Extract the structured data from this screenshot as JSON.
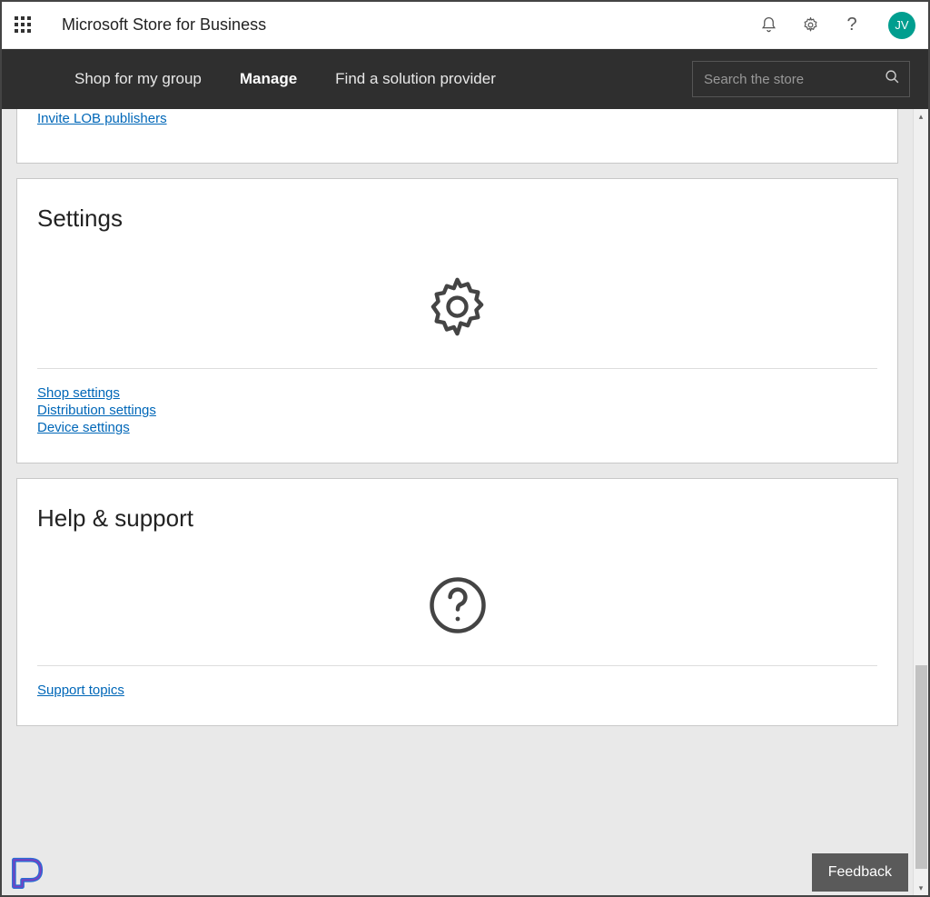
{
  "header": {
    "brand": "Microsoft Store for Business",
    "avatar_initials": "JV"
  },
  "nav": {
    "items": [
      {
        "label": "Shop for my group",
        "active": false
      },
      {
        "label": "Manage",
        "active": true
      },
      {
        "label": "Find a solution provider",
        "active": false
      }
    ],
    "search_placeholder": "Search the store"
  },
  "cards": {
    "partial": {
      "links": [
        "Invite LOB publishers"
      ]
    },
    "settings": {
      "title": "Settings",
      "links": [
        "Shop settings",
        "Distribution settings",
        "Device settings"
      ]
    },
    "help": {
      "title": "Help & support",
      "links": [
        "Support topics"
      ]
    }
  },
  "feedback_label": "Feedback"
}
